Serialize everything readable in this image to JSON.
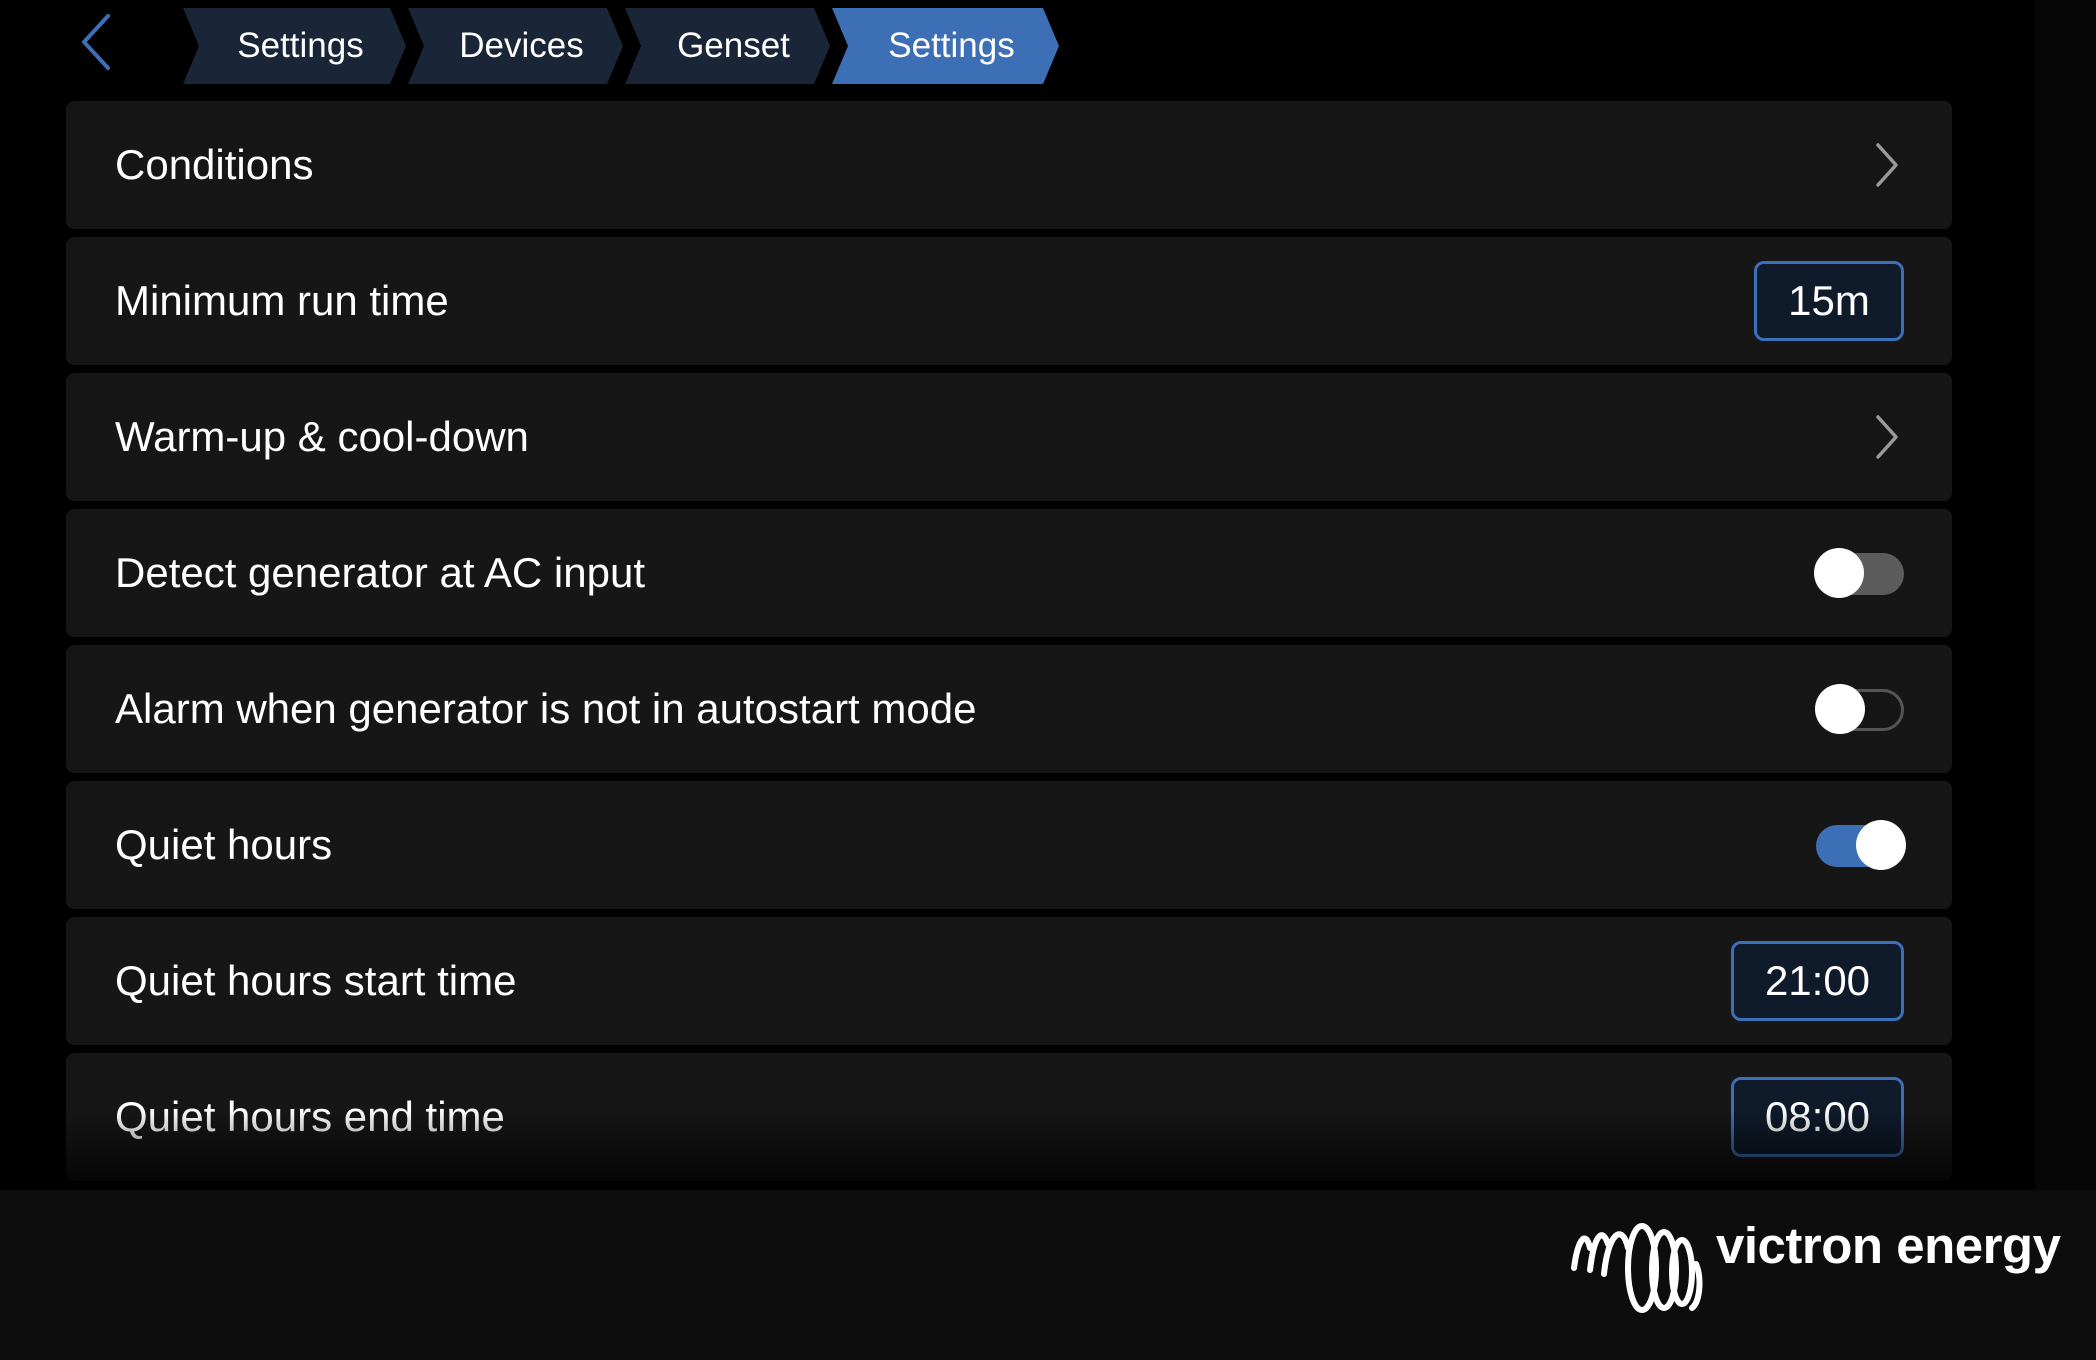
{
  "header": {
    "back_icon": "chevron-left-icon",
    "breadcrumbs": [
      "Settings",
      "Devices",
      "Genset",
      "Settings"
    ],
    "active_crumb_color": "#3d6fb7"
  },
  "rows": [
    {
      "label": "Conditions",
      "type": "link",
      "icon": "chevron-right-icon"
    },
    {
      "label": "Minimum run time",
      "type": "value",
      "value": "15m"
    },
    {
      "label": "Warm-up & cool-down",
      "type": "link",
      "icon": "chevron-right-icon"
    },
    {
      "label": "Detect generator at AC input",
      "type": "toggle",
      "state": "off"
    },
    {
      "label": "Alarm when generator is not in autostart mode",
      "type": "toggle",
      "state": "off"
    },
    {
      "label": "Quiet hours",
      "type": "toggle",
      "state": "on"
    },
    {
      "label": "Quiet hours start time",
      "type": "value",
      "value": "21:00"
    },
    {
      "label": "Quiet hours end time",
      "type": "value",
      "value": "08:00"
    }
  ],
  "branding": {
    "logo_text": "victron energy",
    "logo_icon": "victron-spring-icon"
  }
}
